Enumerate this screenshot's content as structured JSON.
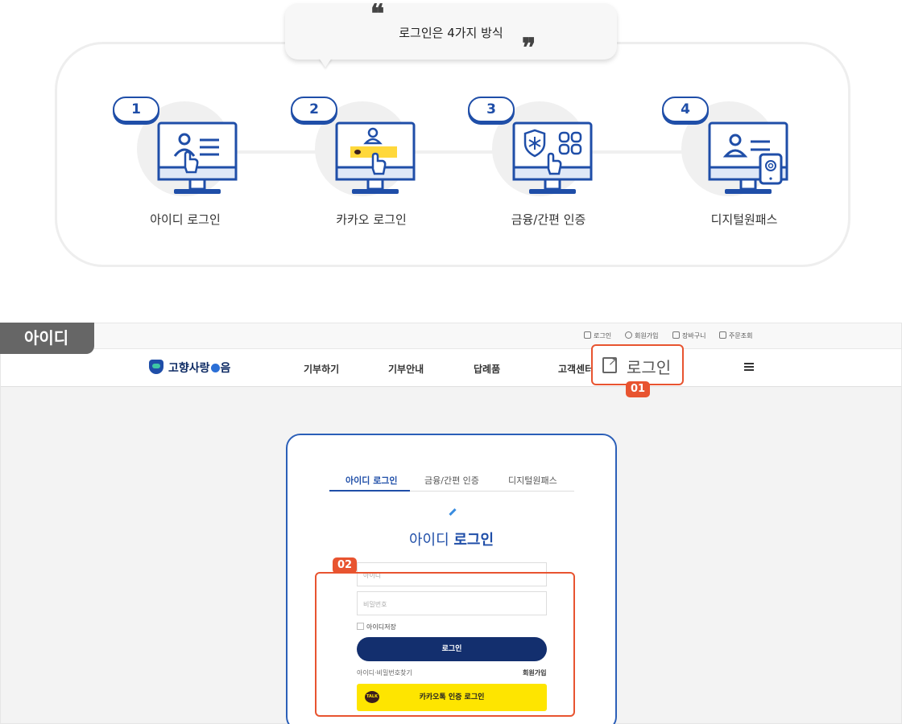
{
  "overview": {
    "bubble_text": "로그인은 4가지 방식",
    "quote_open": "❝",
    "quote_close": "❞",
    "steps": [
      {
        "number": "1",
        "label": "아이디 로그인",
        "icon": "id-login-monitor-icon"
      },
      {
        "number": "2",
        "label": "카카오 로그인",
        "icon": "kakao-login-monitor-icon"
      },
      {
        "number": "3",
        "label": "금융/간편 인증",
        "icon": "finance-auth-monitor-icon"
      },
      {
        "number": "4",
        "label": "디지털원패스",
        "icon": "digital-onepass-monitor-icon"
      }
    ]
  },
  "section_tag": "아이디",
  "site": {
    "util_links": [
      "로그인",
      "회원가입",
      "장바구니",
      "주문조회"
    ],
    "logo_text_before": "고향사랑",
    "logo_text_after": "음",
    "nav_menu": [
      "기부하기",
      "기부안내",
      "답례품",
      "고객센터"
    ],
    "header_login_label": "로그인",
    "badges": {
      "first": "01",
      "second": "02"
    },
    "login_card": {
      "tabs": [
        "아이디 로그인",
        "금융/간편 인증",
        "디지털원패스"
      ],
      "title_light": "아이디 ",
      "title_bold": "로그인",
      "id_placeholder": "아이디",
      "pw_placeholder": "비밀번호",
      "save_id_label": "아이디저장",
      "login_button": "로그인",
      "find_link": "아이디·비밀번호찾기",
      "join_link": "회원가입",
      "kakao_button": "카카오톡 인증 로그인",
      "kakao_talk_badge": "TALK"
    }
  },
  "colors": {
    "brand_blue": "#1f4ea8",
    "navy": "#132f6e",
    "callout": "#e85430",
    "kakao_yellow": "#fee500",
    "monitor_yellow": "#ffd83b"
  }
}
